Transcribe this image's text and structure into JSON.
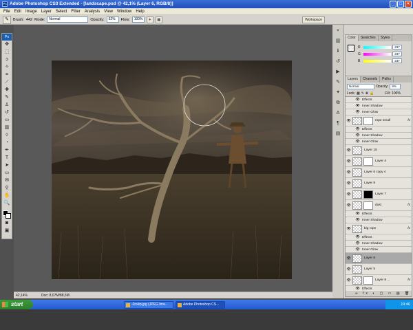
{
  "title": "Adobe Photoshop CS3 Extended - [landscape.psd @ 42,1% (Layer 6, RGB/8)]",
  "app_icon_label": "Ps",
  "menu": [
    "File",
    "Edit",
    "Image",
    "Layer",
    "Select",
    "Filter",
    "Analysis",
    "View",
    "Window",
    "Help"
  ],
  "options": {
    "brush_label": "Brush:",
    "brush_size": "442",
    "mode_label": "Mode:",
    "mode_value": "Normal",
    "opacity_label": "Opacity:",
    "opacity_value": "62%",
    "flow_label": "Flow:",
    "flow_value": "100%",
    "workspace_label": "Workspace"
  },
  "toolbox": {
    "ps_logo": "Ps"
  },
  "status": {
    "zoom": "42,14%",
    "doc": "Doc: 8,07M/88,6M"
  },
  "color_panel": {
    "tabs": [
      "Color",
      "Swatches",
      "Styles"
    ],
    "channels": [
      {
        "name": "R",
        "value": "237"
      },
      {
        "name": "G",
        "value": "237"
      },
      {
        "name": "B",
        "value": "237"
      }
    ]
  },
  "layers_panel": {
    "tabs": [
      "Layers",
      "Channels",
      "Paths"
    ],
    "blend_mode": "Normal",
    "opacity_label": "Opacity:",
    "opacity_value": "8%",
    "lock_label": "Lock:",
    "fill_label": "Fill:",
    "fill_value": "100%",
    "bottom_icons": "∞ fx ◐ ▢ ▭ ▤ 🗑"
  },
  "layers": [
    {
      "kind": "effect",
      "name": "Effects"
    },
    {
      "kind": "effect",
      "name": "Inner Shadow"
    },
    {
      "kind": "effect",
      "name": "Inner Glow"
    },
    {
      "kind": "layer",
      "name": "rope small",
      "fx": "fx",
      "mask": "white"
    },
    {
      "kind": "effect",
      "name": "Effects"
    },
    {
      "kind": "effect",
      "name": "Inner Shadow"
    },
    {
      "kind": "effect",
      "name": "Inner Glow"
    },
    {
      "kind": "layer",
      "name": "Layer 16",
      "fx": "",
      "mask": "none"
    },
    {
      "kind": "layer",
      "name": "Layer 4",
      "fx": "",
      "mask": "white"
    },
    {
      "kind": "layer",
      "name": "Layer 6 copy 4",
      "fx": "",
      "mask": "none"
    },
    {
      "kind": "layer",
      "name": "Layer 8",
      "fx": "",
      "mask": "none"
    },
    {
      "kind": "layer",
      "name": "Layer 7",
      "fx": "",
      "mask": "dark"
    },
    {
      "kind": "layer",
      "name": "dust",
      "fx": "fx",
      "mask": "white"
    },
    {
      "kind": "effect",
      "name": "Effects"
    },
    {
      "kind": "effect",
      "name": "Inner Shadow"
    },
    {
      "kind": "layer",
      "name": "big rope",
      "fx": "fx",
      "mask": "none"
    },
    {
      "kind": "effect",
      "name": "Effects"
    },
    {
      "kind": "effect",
      "name": "Inner Shadow"
    },
    {
      "kind": "effect",
      "name": "Inner Glow"
    },
    {
      "kind": "layer",
      "name": "Layer 6",
      "fx": "",
      "mask": "none",
      "selected": true
    },
    {
      "kind": "layer",
      "name": "Layer 5",
      "fx": "",
      "mask": "none"
    },
    {
      "kind": "layer",
      "name": "Layer 8 ...",
      "fx": "fx",
      "mask": "white"
    },
    {
      "kind": "effect",
      "name": "Effects"
    },
    {
      "kind": "effect",
      "name": "Inner Shadow"
    }
  ],
  "taskbar": {
    "start": "start",
    "items": [
      {
        "label": "-0cvkp.jpg (JPEG Ima...",
        "active": false
      },
      {
        "label": "Adobe Photoshop CS...",
        "active": true
      }
    ],
    "clock": "19:40"
  },
  "icons": {
    "minimize": "minimize-icon",
    "maximize": "maximize-icon",
    "close": "close-icon"
  }
}
